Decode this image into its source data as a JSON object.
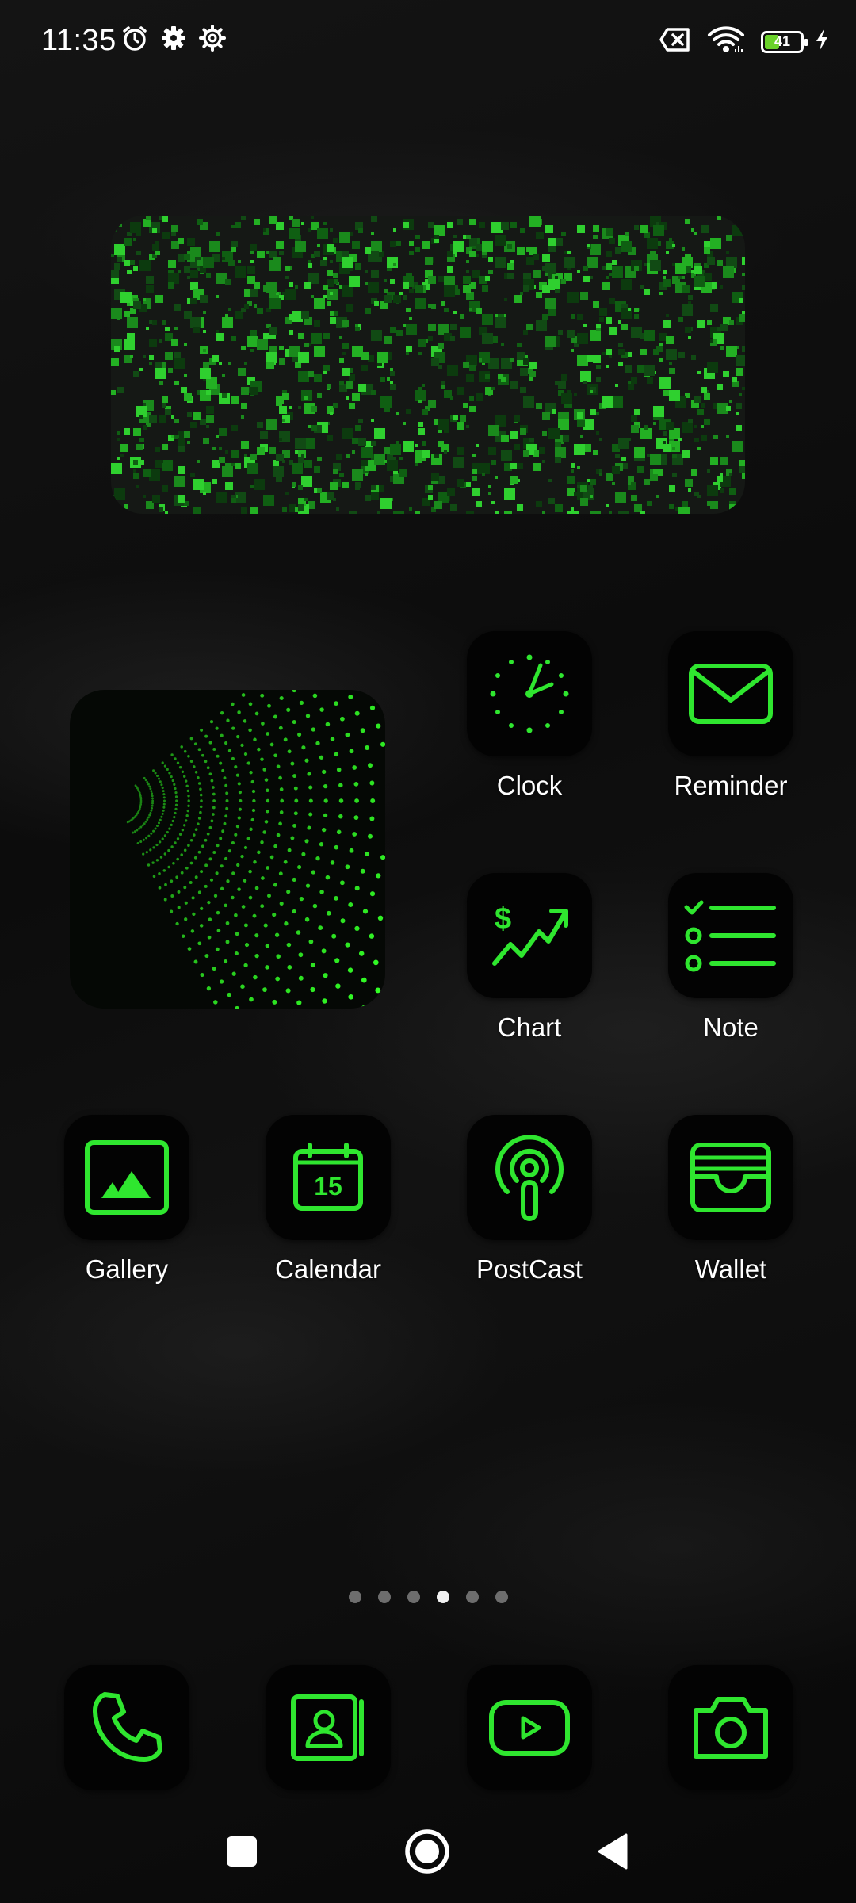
{
  "status_bar": {
    "time": "11:35",
    "battery_level": "41",
    "battery_fraction": 0.41,
    "icons_left": [
      "alarm-icon",
      "gear-icon",
      "cog-outline-icon"
    ],
    "icons_right": [
      "sim-off-icon",
      "wifi-icon",
      "battery-icon",
      "charging-bolt-icon"
    ]
  },
  "home": {
    "apps": [
      {
        "label": "Clock",
        "icon": "clock-icon"
      },
      {
        "label": "Reminder",
        "icon": "mail-icon"
      },
      {
        "label": "Chart",
        "icon": "chart-dollar-icon"
      },
      {
        "label": "Note",
        "icon": "checklist-icon"
      },
      {
        "label": "Gallery",
        "icon": "image-icon"
      },
      {
        "label": "Calendar",
        "icon": "calendar-icon",
        "date": "15"
      },
      {
        "label": "PostCast",
        "icon": "podcast-icon"
      },
      {
        "label": "Wallet",
        "icon": "wallet-icon"
      }
    ],
    "page_indicator": {
      "pages": 6,
      "current": 4
    }
  },
  "dock": [
    {
      "icon": "phone-icon"
    },
    {
      "icon": "contacts-icon"
    },
    {
      "icon": "video-play-icon"
    },
    {
      "icon": "camera-icon"
    }
  ],
  "nav_bar": [
    "recents-square-icon",
    "home-circle-icon",
    "back-triangle-icon"
  ],
  "colors": {
    "accent": "#2fe62f",
    "tile": "#030303",
    "text": "#ffffff"
  }
}
